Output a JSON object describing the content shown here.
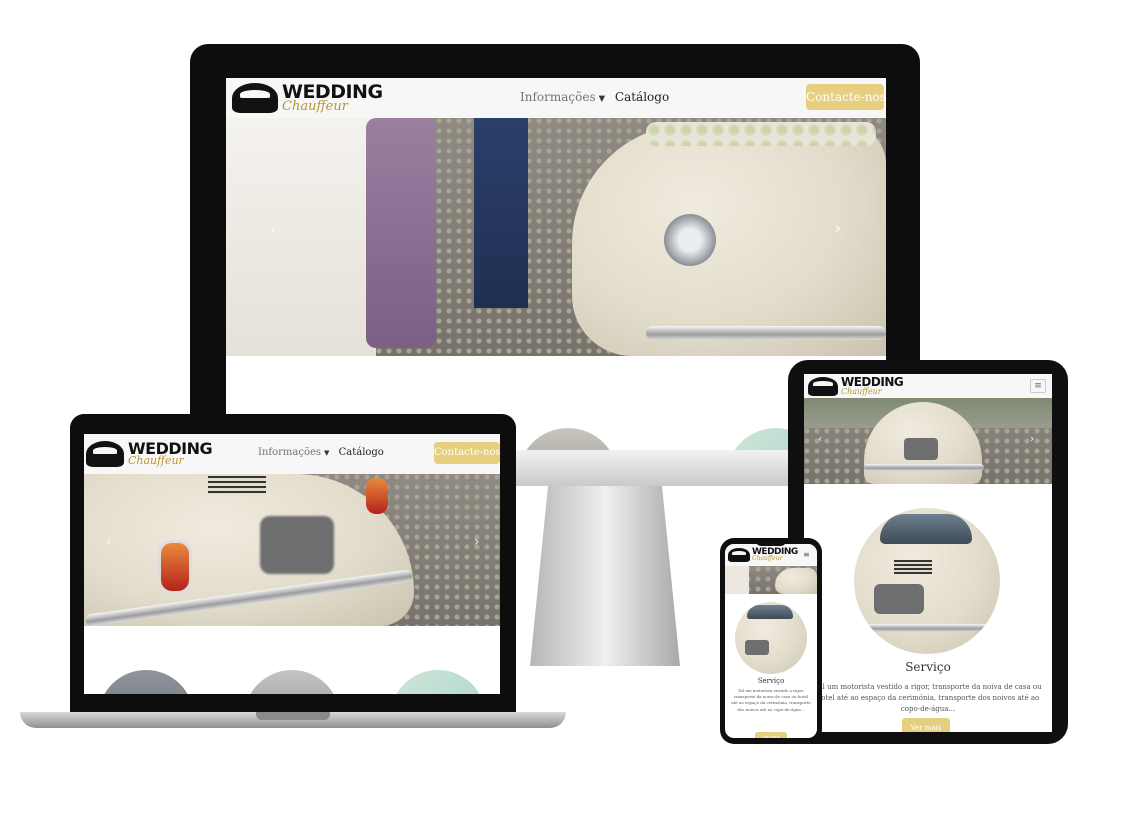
{
  "brand": {
    "word": "WEDDING",
    "script": "Chauffeur"
  },
  "nav": {
    "menu_label": "Informações",
    "catalog_label": "Catálogo",
    "cta_label": "Contacte-nos"
  },
  "carousel": {
    "prev_icon": "chevron-left-icon",
    "next_icon": "chevron-right-icon"
  },
  "service": {
    "title": "Serviço",
    "tablet_description": "Tal um motorista vestido a rigor, transporte da noiva de casa ou hotel até ao espaço da cerimónia, transporte dos noivos até ao copo-de-água...",
    "phone_description": "Tal um motorista vestido a rigor, transporte da noiva de casa ou hotel até ao espaço da cerimónia, transporte dos noivos até ao copo-de-água...",
    "button_label": "Ver mais"
  },
  "colors": {
    "accent": "#e6cf7e",
    "script_gold": "#b8962e",
    "device_frame": "#111111"
  }
}
